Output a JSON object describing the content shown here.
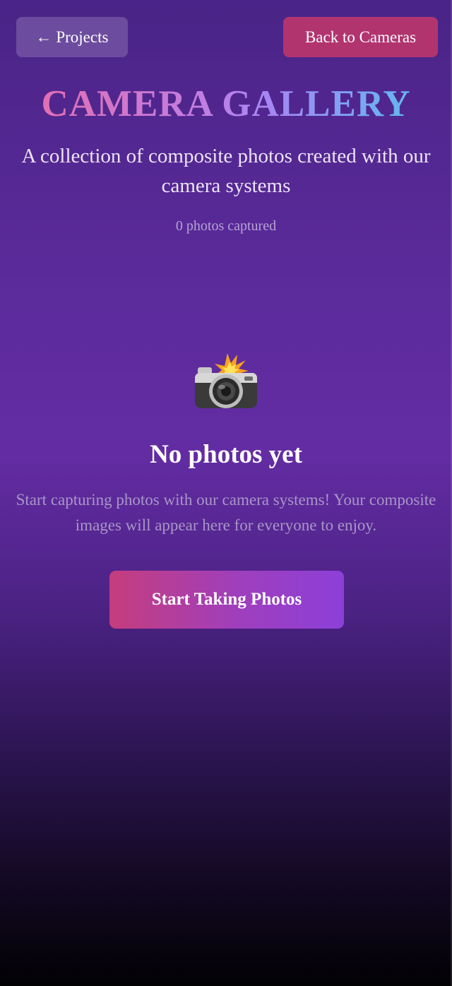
{
  "header": {
    "projects_label": "← Projects",
    "back_label": "Back to Cameras"
  },
  "gallery": {
    "title": "CAMERA GALLERY",
    "subtitle": "A collection of composite photos created with our camera systems",
    "count_text": "0 photos captured"
  },
  "empty_state": {
    "icon": "camera-flash-icon",
    "title": "No photos yet",
    "description": "Start capturing photos with our camera systems! Your composite images will appear here for everyone to enjoy.",
    "cta_label": "Start Taking Photos"
  },
  "colors": {
    "back_button": "#b2346f",
    "cta_gradient_start": "#c53d7d",
    "cta_gradient_end": "#8c3fd8",
    "title_gradient_start": "#e16fb2",
    "title_gradient_end": "#63b9ef",
    "background_top": "#4a2487",
    "background_bottom": "#020104"
  }
}
